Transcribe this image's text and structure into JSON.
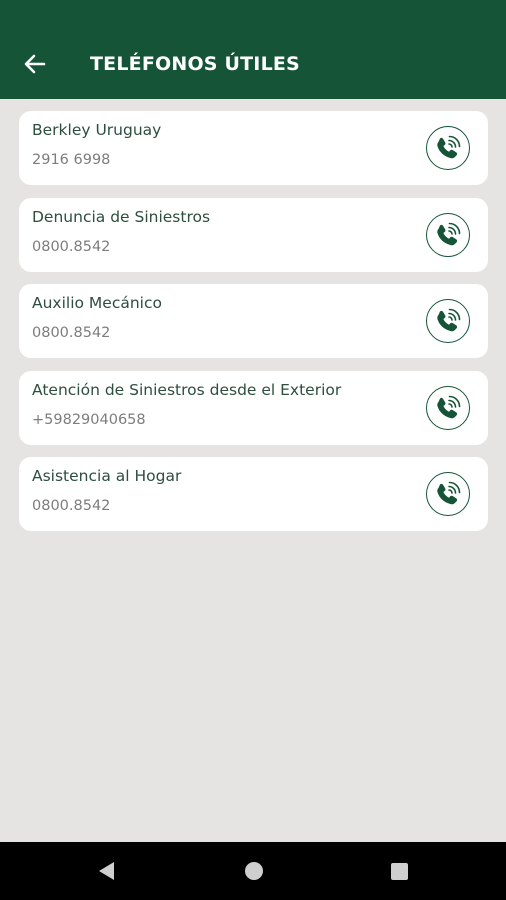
{
  "app_bar": {
    "title": "TELÉFONOS ÚTILES",
    "back_icon": "arrow-left-icon",
    "background_color": "#165437",
    "title_color": "#ffffff"
  },
  "contacts": [
    {
      "name": "Berkley Uruguay",
      "phone": "2916 6998",
      "call_icon": "phone-call-icon"
    },
    {
      "name": "Denuncia de Siniestros",
      "phone": "0800.8542",
      "call_icon": "phone-call-icon"
    },
    {
      "name": "Auxilio Mecánico",
      "phone": "0800.8542",
      "call_icon": "phone-call-icon"
    },
    {
      "name": "Atención de Siniestros desde el Exterior",
      "phone": "+59829040658",
      "call_icon": "phone-call-icon"
    },
    {
      "name": "Asistencia al Hogar",
      "phone": "0800.8542",
      "call_icon": "phone-call-icon"
    }
  ],
  "nav_bar": {
    "back_icon": "triangle-back-icon",
    "home_icon": "circle-home-icon",
    "recents_icon": "square-recents-icon"
  },
  "colors": {
    "background": "#e5e4e2",
    "card": "#ffffff",
    "accent": "#165437",
    "text_primary": "#2e4e40",
    "text_secondary": "#7d7d7d"
  }
}
